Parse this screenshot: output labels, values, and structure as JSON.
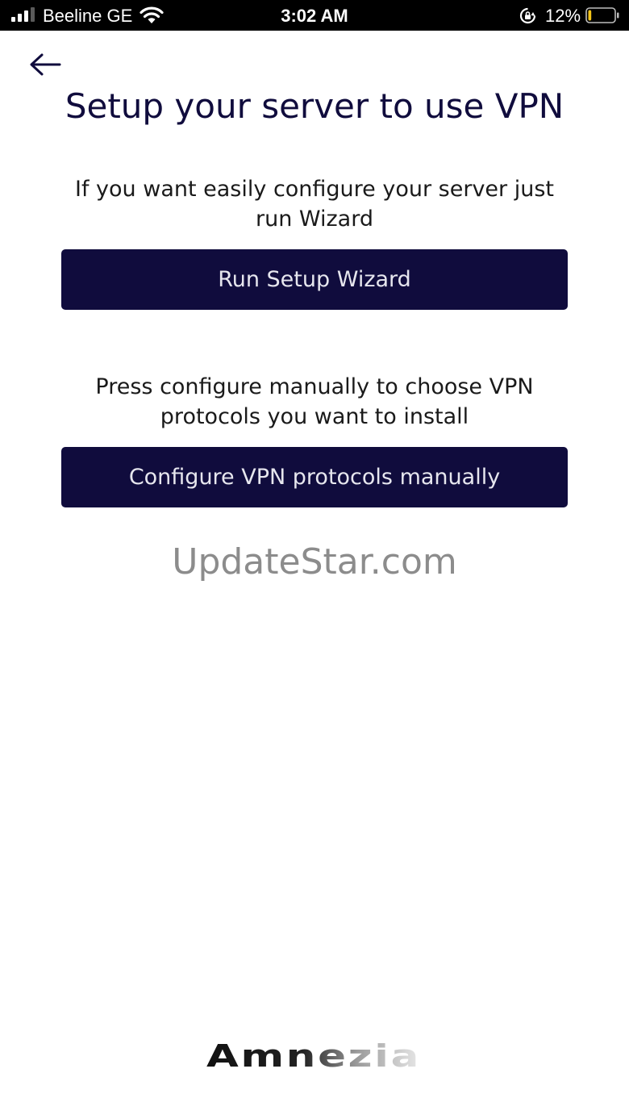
{
  "status_bar": {
    "carrier": "Beeline GE",
    "time": "3:02 AM",
    "battery_percent": "12%",
    "battery_level": 0.12,
    "icons": [
      "signal-icon",
      "wifi-icon",
      "rotation-lock-icon",
      "battery-icon"
    ]
  },
  "nav": {
    "back_icon": "arrow-left-icon"
  },
  "page": {
    "title": "Setup your server to use VPN",
    "wizard_description": "If you want easily configure your server just run Wizard",
    "wizard_button": "Run Setup Wizard",
    "manual_description": "Press configure manually to choose VPN protocols you want to install",
    "manual_button": "Configure VPN protocols manually"
  },
  "watermark": "UpdateStar.com",
  "brand": {
    "name": "Amnezia"
  },
  "colors": {
    "primary": "#100c3d",
    "button_text": "#e6e6ee",
    "status_bar_bg": "#000000",
    "battery_low": "#f5c518",
    "watermark": "#8c8c8c"
  }
}
